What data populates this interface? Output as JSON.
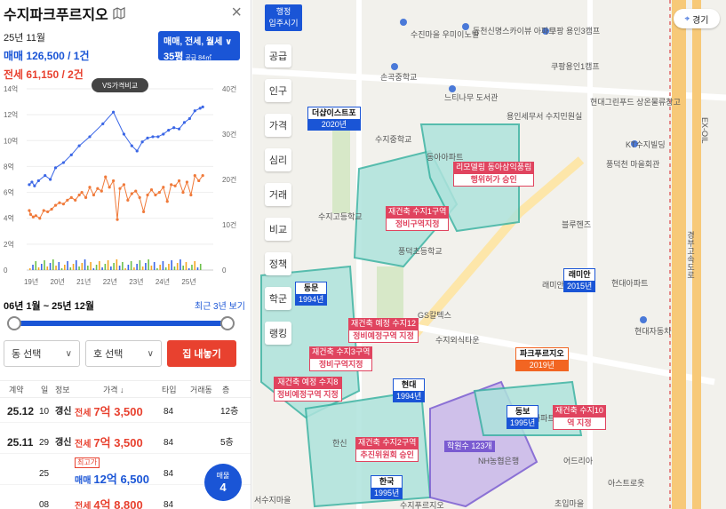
{
  "panel": {
    "title": "수지파크푸르지오",
    "close_label": "×",
    "summary": {
      "date": "25년 11월",
      "sale_line": "매매 126,500 / 1건",
      "rent_line": "전세 61,150 / 2건"
    },
    "filter": {
      "types": "매매, 전세, 월세 ∨",
      "size": "35평",
      "size_note": "공급 84㎡"
    },
    "compare_button": "VS가격비교",
    "period_range": "06년 1월 ~ 25년 12월",
    "recent_link": "최근 3년 보기",
    "dong_select": "동 선택",
    "ho_select": "호 선택",
    "list_button": "집 내놓기",
    "table_headers": [
      "계약",
      "일",
      "정보",
      "가격 ↓",
      "타입",
      "거래동",
      "층"
    ],
    "rows": [
      {
        "month": "25.12",
        "day": "10",
        "info": "갱신",
        "kind": "전세",
        "price": "7억 3,500",
        "type": "84",
        "floor": "12층",
        "color": "#e8412f"
      },
      {
        "month": "25.11",
        "day": "29",
        "info": "갱신",
        "kind": "전세",
        "price": "7억 3,500",
        "type": "84",
        "floor": "5층",
        "color": "#e8412f"
      },
      {
        "month": "",
        "day": "25",
        "info": "",
        "kind": "매매",
        "price": "12억 6,500",
        "type": "84",
        "floor": "5층",
        "color": "#1a55d6",
        "badge": "최고가"
      },
      {
        "month": "",
        "day": "08",
        "info": "",
        "kind": "전세",
        "price": "4억 8,800",
        "type": "84",
        "floor": "",
        "color": "#e8412f"
      }
    ],
    "fab": {
      "label": "매물",
      "count": "4"
    }
  },
  "chart_data": {
    "type": "line",
    "x_ticks": [
      "19년",
      "20년",
      "21년",
      "22년",
      "23년",
      "24년",
      "25년"
    ],
    "y_left_ticks": [
      "14억",
      "12억",
      "10억",
      "8억",
      "6억",
      "4억",
      "2억",
      "0"
    ],
    "y_right_ticks": [
      "40건",
      "30건",
      "20건",
      "10건",
      "0"
    ],
    "ylim_left": [
      0,
      14
    ],
    "ylim_right": [
      0,
      40
    ],
    "series": [
      {
        "color": "#3a66e6",
        "values": [
          [
            2019.0,
            6.6
          ],
          [
            2019.1,
            6.8
          ],
          [
            2019.2,
            6.5
          ],
          [
            2019.35,
            6.9
          ],
          [
            2019.6,
            7.3
          ],
          [
            2019.8,
            7.0
          ],
          [
            2020.0,
            7.9
          ],
          [
            2020.3,
            8.3
          ],
          [
            2020.6,
            8.9
          ],
          [
            2020.9,
            9.6
          ],
          [
            2021.3,
            10.3
          ],
          [
            2021.8,
            11.3
          ],
          [
            2022.2,
            12.2
          ],
          [
            2022.6,
            10.5
          ],
          [
            2022.9,
            9.6
          ],
          [
            2023.1,
            9.2
          ],
          [
            2023.3,
            9.9
          ],
          [
            2023.5,
            10.2
          ],
          [
            2023.7,
            10.3
          ],
          [
            2023.9,
            10.3
          ],
          [
            2024.1,
            10.5
          ],
          [
            2024.3,
            10.8
          ],
          [
            2024.5,
            11.0
          ],
          [
            2024.7,
            10.9
          ],
          [
            2024.9,
            11.4
          ],
          [
            2025.1,
            11.7
          ],
          [
            2025.3,
            12.3
          ],
          [
            2025.5,
            12.5
          ],
          [
            2025.6,
            12.6
          ]
        ]
      },
      {
        "color": "#f07a3a",
        "values": [
          [
            2019.0,
            4.6
          ],
          [
            2019.05,
            4.3
          ],
          [
            2019.15,
            4.1
          ],
          [
            2019.25,
            4.2
          ],
          [
            2019.4,
            4.0
          ],
          [
            2019.55,
            4.6
          ],
          [
            2019.7,
            4.5
          ],
          [
            2019.85,
            4.7
          ],
          [
            2020.0,
            5.0
          ],
          [
            2020.15,
            5.2
          ],
          [
            2020.3,
            5.1
          ],
          [
            2020.45,
            5.4
          ],
          [
            2020.6,
            5.6
          ],
          [
            2020.75,
            5.4
          ],
          [
            2020.9,
            5.8
          ],
          [
            2021.0,
            6.0
          ],
          [
            2021.15,
            5.6
          ],
          [
            2021.3,
            6.4
          ],
          [
            2021.45,
            5.8
          ],
          [
            2021.6,
            6.3
          ],
          [
            2021.75,
            6.1
          ],
          [
            2021.9,
            7.2
          ],
          [
            2022.05,
            6.4
          ],
          [
            2022.2,
            6.9
          ],
          [
            2022.35,
            3.9
          ],
          [
            2022.45,
            6.3
          ],
          [
            2022.6,
            6.6
          ],
          [
            2022.75,
            5.4
          ],
          [
            2022.9,
            5.9
          ],
          [
            2023.05,
            6.1
          ],
          [
            2023.2,
            5.6
          ],
          [
            2023.35,
            4.5
          ],
          [
            2023.5,
            5.8
          ],
          [
            2023.65,
            6.2
          ],
          [
            2023.8,
            5.8
          ],
          [
            2023.95,
            6.0
          ],
          [
            2024.1,
            6.4
          ],
          [
            2024.25,
            5.3
          ],
          [
            2024.4,
            6.6
          ],
          [
            2024.55,
            6.5
          ],
          [
            2024.7,
            6.9
          ],
          [
            2024.85,
            6.0
          ],
          [
            2025.0,
            6.8
          ],
          [
            2025.15,
            5.8
          ],
          [
            2025.3,
            7.3
          ],
          [
            2025.45,
            6.9
          ],
          [
            2025.6,
            7.3
          ]
        ]
      }
    ]
  },
  "map": {
    "seal": {
      "l1": "행정",
      "l2": "입주시기"
    },
    "compass_label": "경기",
    "toolbar": [
      "공급",
      "인구",
      "가격",
      "심리",
      "거래",
      "비교",
      "정책",
      "학군",
      "랭킹"
    ],
    "labels": [
      "수진마을 우미이노빌",
      "동천신명스카이뷰 아파트",
      "쿠팡 용인3캠프",
      "쿠팡용인1캠프",
      "손곡중학교",
      "느티나무 도서관",
      "용인세무서 수지민원실",
      "현대그린푸드 상온물류창고",
      "수지중학교",
      "동아아파트",
      "KT수지빌딩",
      "풍덕천 마을회관",
      "수지고등학교",
      "블루헨즈",
      "풍덕초등학교",
      "GS칼텍스",
      "수지외식타운",
      "현대아파트",
      "래미안아파트",
      "현대자동차",
      "한신",
      "어드리아",
      "아스트로옷",
      "초입마을",
      "동보2차아파트",
      "NH농협은행",
      "서수지마을",
      "수지푸르지오",
      "경부고속도로",
      "EX-OIL"
    ],
    "apartments": [
      {
        "name": "더샵이스트포",
        "year": "2020년"
      },
      {
        "name": "래미안",
        "year": "2015년"
      },
      {
        "name": "동문",
        "year": "1994년"
      },
      {
        "name": "현대",
        "year": "1994년"
      },
      {
        "name": "동보",
        "year": "1995년"
      },
      {
        "name": "한국",
        "year": "1995년"
      },
      {
        "name": "파크푸르지오",
        "year": "2019년"
      }
    ],
    "redevs": [
      {
        "name": "리모델링 동아삼익풍림",
        "stat": "행위허가 승인"
      },
      {
        "name": "재건축 수지1구역",
        "stat": "정비구역지정"
      },
      {
        "name": "재건축 예정 수지12",
        "stat": "정비예정구역 지정"
      },
      {
        "name": "재건축 수지3구역",
        "stat": "정비구역지정"
      },
      {
        "name": "재건축 예정 수지8",
        "stat": "정비예정구역 지정"
      },
      {
        "name": "재건축 수지2구역",
        "stat": "추진위원회 승인"
      },
      {
        "name": "재건축 수지10",
        "stat": "역 지정"
      },
      {
        "name": "학원수 123개",
        "stat": ""
      }
    ]
  }
}
